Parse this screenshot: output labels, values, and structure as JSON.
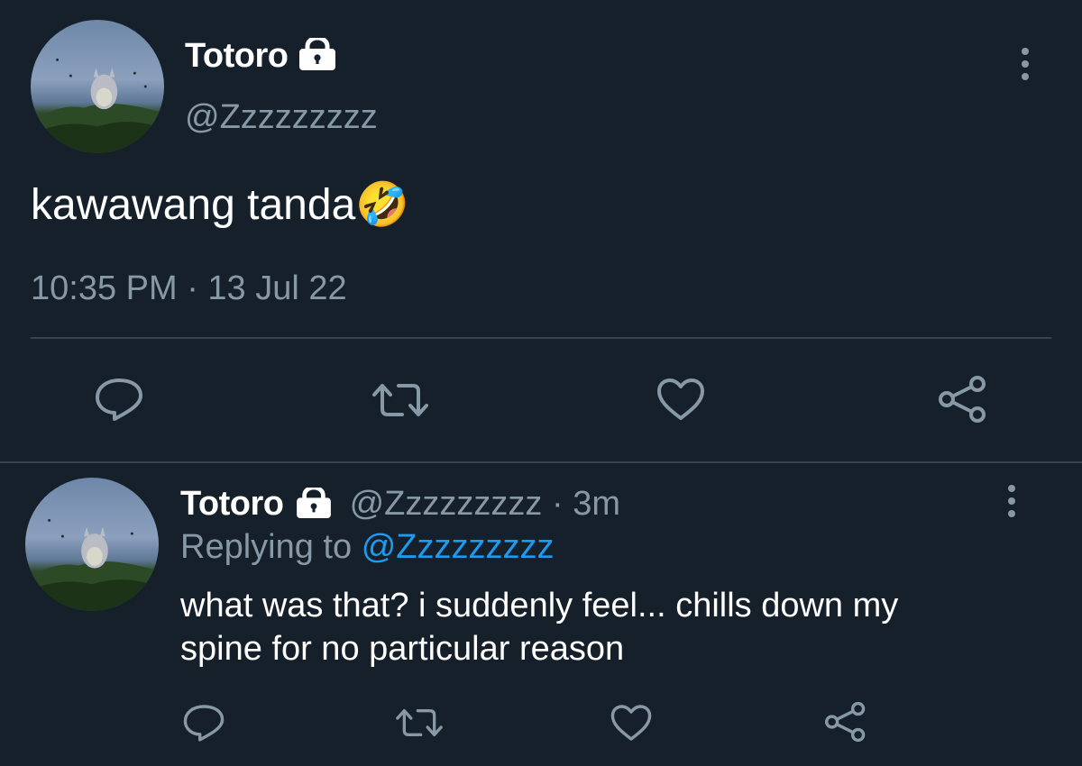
{
  "main_tweet": {
    "display_name": "Totoro",
    "handle": "@Zzzzzzzzz",
    "text": "kawawang tanda",
    "emoji": "🤣",
    "timestamp": "10:35 PM · 13 Jul 22",
    "icons": {
      "lock": "lock-icon",
      "more": "more-vertical-icon",
      "reply": "reply-icon",
      "retweet": "retweet-icon",
      "like": "heart-icon",
      "share": "share-icon"
    }
  },
  "reply_tweet": {
    "display_name": "Totoro",
    "handle": "@Zzzzzzzzz",
    "separator": "·",
    "time_ago": "3m",
    "replying_prefix": "Replying to",
    "replying_handle": "@Zzzzzzzzz",
    "text_line1": "what was that? i suddenly feel... chills down my",
    "text_line2": "spine for no particular reason"
  },
  "colors": {
    "background": "#15202b",
    "text": "#ffffff",
    "muted": "#8899a6",
    "link": "#1d9bf0",
    "divider": "#38444d"
  }
}
